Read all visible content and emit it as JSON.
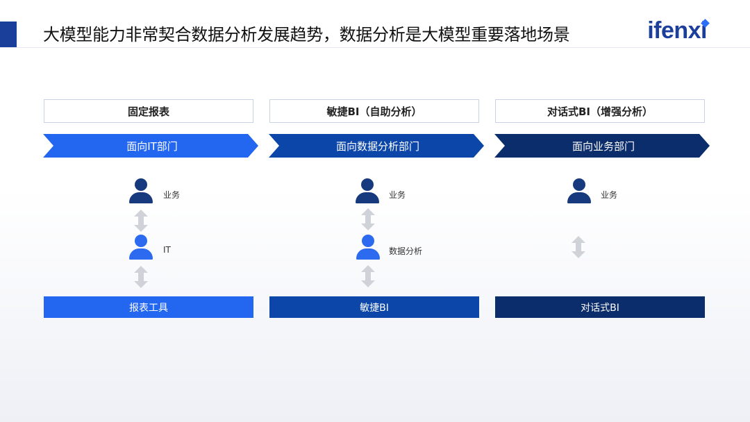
{
  "header": {
    "title": "大模型能力非常契合数据分析发展趋势，数据分析是大模型重要落地场景",
    "logo": "ifenxi"
  },
  "columns": [
    {
      "label": "固定报表",
      "department": "面向IT部门",
      "roles": [
        "业务",
        "IT"
      ],
      "tool": "报表工具"
    },
    {
      "label": "敏捷BI（自助分析）",
      "department": "面向数据分析部门",
      "roles": [
        "业务",
        "数据分析"
      ],
      "tool": "敏捷BI"
    },
    {
      "label": "对话式BI（增强分析）",
      "department": "面向业务部门",
      "roles": [
        "业务"
      ],
      "tool": "对话式BI"
    }
  ],
  "colors": {
    "accent": "#1a3f9a",
    "stage1": "#2366f0",
    "stage2": "#0b46a8",
    "stage3": "#0c2d6b",
    "person_dark": "#173a7e",
    "person_blue": "#2c6af0",
    "arrow_gray": "#cfd2d8"
  },
  "icons": [
    "person-icon",
    "double-arrow-icon"
  ]
}
